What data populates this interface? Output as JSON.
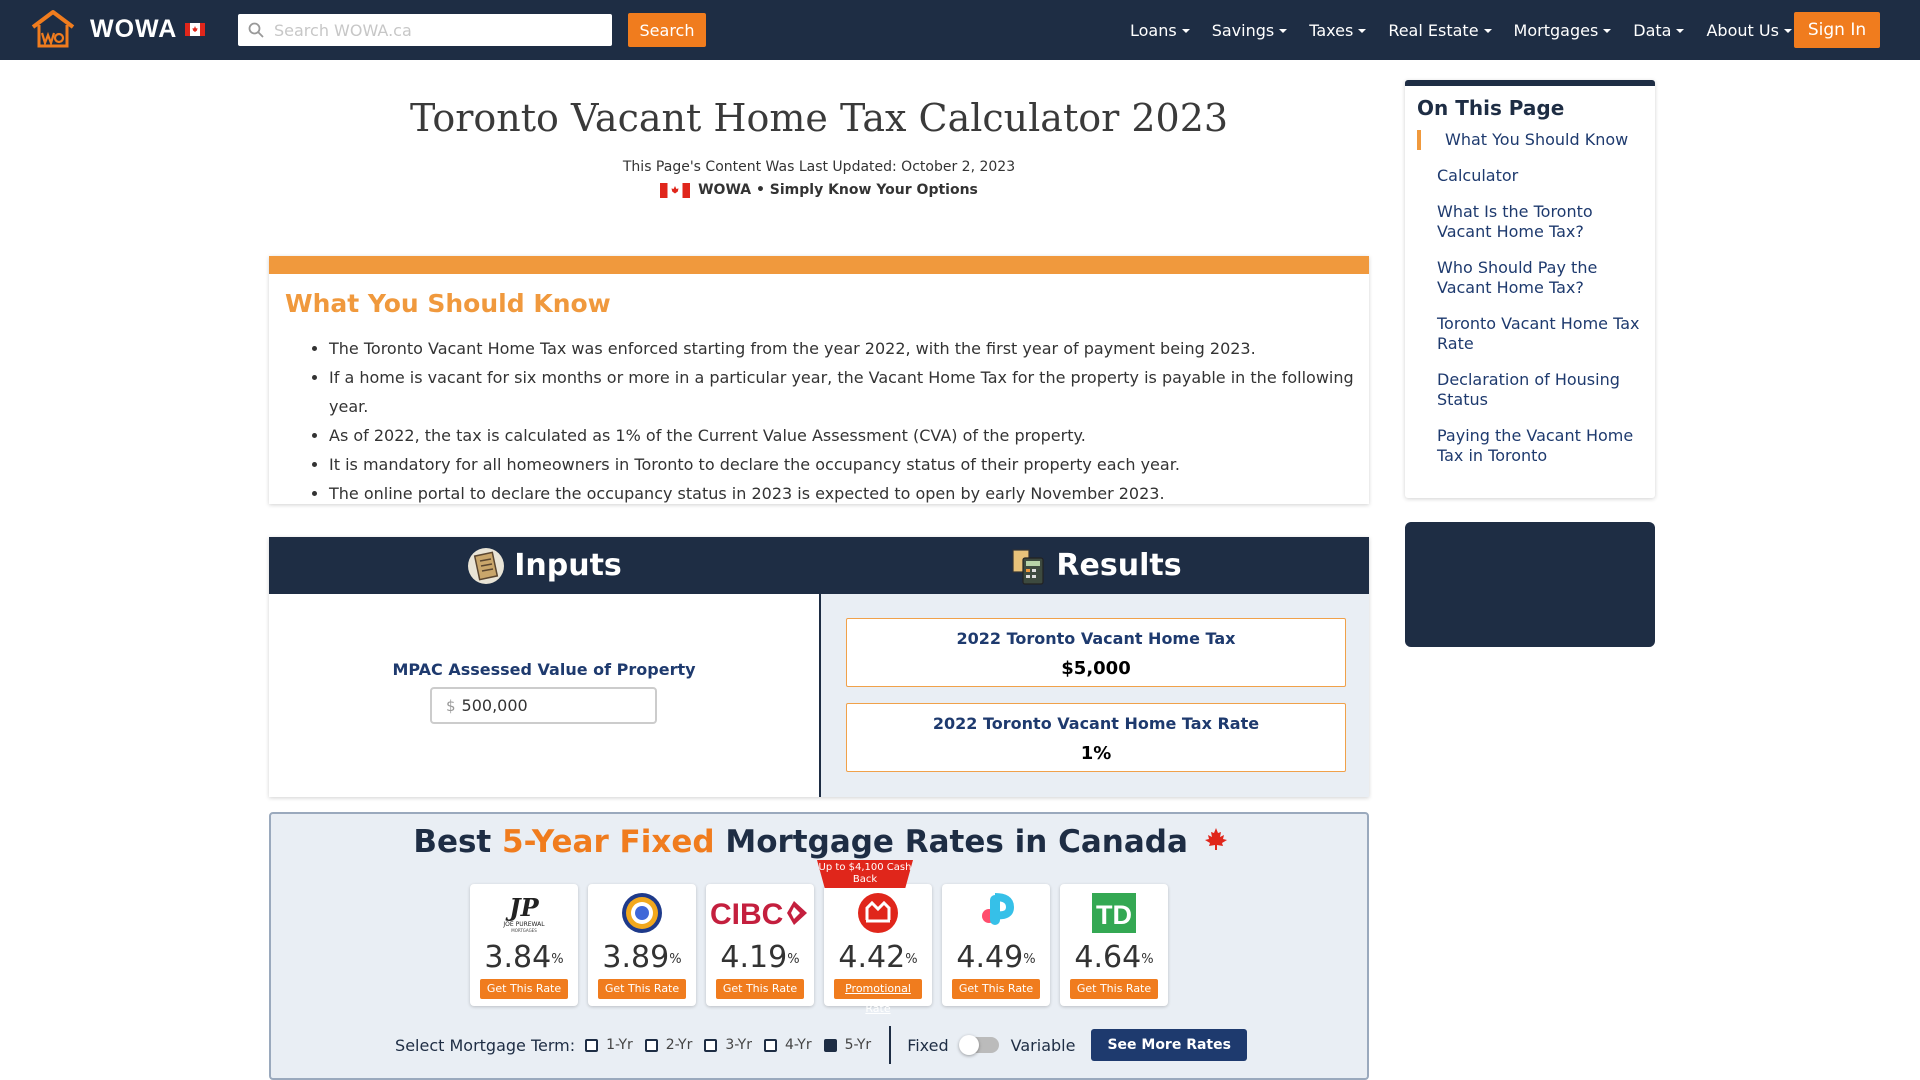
{
  "nav": {
    "logo_text": "WOWA",
    "search_placeholder": "Search WOWA.ca",
    "search_button": "Search",
    "menu": [
      "Loans",
      "Savings",
      "Taxes",
      "Real Estate",
      "Mortgages",
      "Data",
      "About Us"
    ],
    "signin": "Sign In"
  },
  "header": {
    "title": "Toronto Vacant Home Tax Calculator 2023",
    "updated": "This Page's Content Was Last Updated: October 2, 2023",
    "tagline": "WOWA • Simply Know Your Options"
  },
  "know": {
    "title": "What You Should Know",
    "items": [
      "The Toronto Vacant Home Tax was enforced starting from the year 2022, with the first year of payment being 2023.",
      "If a home is vacant for six months or more in a particular year, the Vacant Home Tax for the property is payable in the following year.",
      "As of 2022, the tax is calculated as 1% of the Current Value Assessment (CVA) of the property.",
      "It is mandatory for all homeowners in Toronto to declare the occupancy status of their property each year.",
      "The online portal to declare the occupancy status in 2023 is expected to open by early November 2023."
    ]
  },
  "calculator": {
    "inputs_title": "Inputs",
    "results_title": "Results",
    "mpac_label": "MPAC Assessed Value of Property",
    "currency_symbol": "$",
    "mpac_value": "500,000",
    "results": [
      {
        "label": "2022 Toronto Vacant Home Tax",
        "value": "$5,000"
      },
      {
        "label": "2022 Toronto Vacant Home Tax Rate",
        "value": "1%"
      }
    ]
  },
  "rates": {
    "title_prefix": "Best ",
    "title_accent": "5-Year Fixed",
    "title_suffix": " Mortgage Rates in Canada",
    "promo_ribbon": "Up to $4,100 Cash Back",
    "lenders": [
      {
        "logo": "joe-purewal-logo",
        "rate": "3.84",
        "button": "Get This Rate"
      },
      {
        "logo": "target-logo",
        "rate": "3.89",
        "button": "Get This Rate"
      },
      {
        "logo": "CIBC",
        "rate": "4.19",
        "button": "Get This Rate"
      },
      {
        "logo": "bmo-logo",
        "rate": "4.42",
        "button": "Promotional Rate"
      },
      {
        "logo": "p-logo",
        "rate": "4.49",
        "button": "Get This Rate"
      },
      {
        "logo": "TD",
        "rate": "4.64",
        "button": "Get This Rate"
      }
    ],
    "percent_sign": "%",
    "term_label": "Select Mortgage Term:",
    "terms": [
      "1-Yr",
      "2-Yr",
      "3-Yr",
      "4-Yr",
      "5-Yr"
    ],
    "selected_term": "5-Yr",
    "fixed_label": "Fixed",
    "variable_label": "Variable",
    "more_button": "See More Rates"
  },
  "toc": {
    "title": "On This Page",
    "items": [
      "What You Should Know",
      "Calculator",
      "What Is the Toronto Vacant Home Tax?",
      "Who Should Pay the Vacant Home Tax?",
      "Toronto Vacant Home Tax Rate",
      "Declaration of Housing Status",
      "Paying the Vacant Home Tax in Toronto"
    ]
  },
  "colors": {
    "navy": "#1e2d44",
    "orange": "#f07c1e",
    "light_orange": "#f0993d",
    "link_blue": "#1e3a6e"
  }
}
